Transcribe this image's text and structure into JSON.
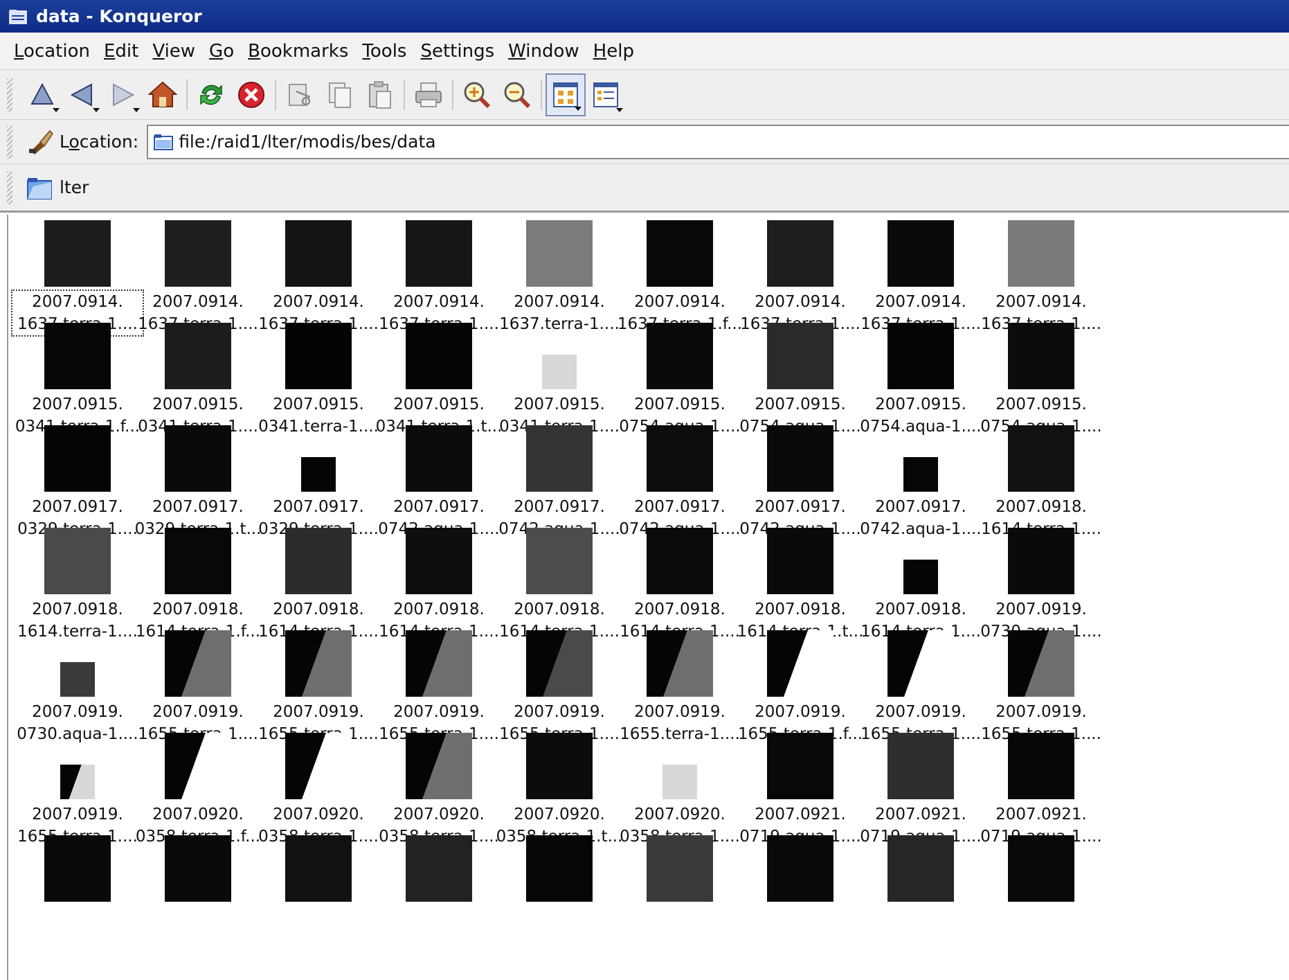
{
  "window": {
    "title": "data - Konqueror"
  },
  "menu": [
    {
      "label": "Location",
      "key": "L",
      "rest": "ocation"
    },
    {
      "label": "Edit",
      "key": "E",
      "rest": "dit"
    },
    {
      "label": "View",
      "key": "V",
      "rest": "iew"
    },
    {
      "label": "Go",
      "key": "G",
      "rest": "o"
    },
    {
      "label": "Bookmarks",
      "key": "B",
      "rest": "ookmarks"
    },
    {
      "label": "Tools",
      "key": "T",
      "rest": "ools"
    },
    {
      "label": "Settings",
      "key": "S",
      "rest": "ettings"
    },
    {
      "label": "Window",
      "key": "W",
      "rest": "indow"
    },
    {
      "label": "Help",
      "key": "H",
      "rest": "elp"
    }
  ],
  "toolbar": {
    "buttons": [
      "up-icon",
      "back-icon",
      "forward-icon",
      "home-icon",
      "reload-icon",
      "stop-icon",
      "cut-icon",
      "copy-icon",
      "paste-icon",
      "print-icon",
      "zoom-in-icon",
      "zoom-out-icon",
      "icon-view-icon",
      "detail-view-icon"
    ]
  },
  "location": {
    "label": "Location:",
    "label_key": "o",
    "value": "file:/raid1/lter/modis/bes/data"
  },
  "bookmarks": [
    {
      "label": "lter"
    }
  ],
  "files": [
    {
      "l1": "2007.0914.",
      "l2": "1637.terra-1....",
      "tone": "#1d1d1d"
    },
    {
      "l1": "2007.0914.",
      "l2": "1637.terra-1....",
      "tone": "#1f1f1f"
    },
    {
      "l1": "2007.0914.",
      "l2": "1637.terra-1....",
      "tone": "#141414"
    },
    {
      "l1": "2007.0914.",
      "l2": "1637.terra-1....",
      "tone": "#161616"
    },
    {
      "l1": "2007.0914.",
      "l2": "1637.terra-1....",
      "tone": "#7b7b7b"
    },
    {
      "l1": "2007.0914.",
      "l2": "1637.terra-1.f...",
      "tone": "#080808"
    },
    {
      "l1": "2007.0914.",
      "l2": "1637.terra-1....",
      "tone": "#1e1e1e"
    },
    {
      "l1": "2007.0914.",
      "l2": "1637.terra-1....",
      "tone": "#0a0a0a"
    },
    {
      "l1": "2007.0914.",
      "l2": "1637.terra-1....",
      "tone": "#7a7a7a"
    },
    {
      "l1": "2007.0915.",
      "l2": "0341.terra-1.f...",
      "tone": "#060606"
    },
    {
      "l1": "2007.0915.",
      "l2": "0341.terra-1....",
      "tone": "#1c1c1c"
    },
    {
      "l1": "2007.0915.",
      "l2": "0341.terra-1....",
      "tone": "#030303"
    },
    {
      "l1": "2007.0915.",
      "l2": "0341.terra-1.t...",
      "tone": "#050505"
    },
    {
      "l1": "2007.0915.",
      "l2": "0341.terra-1....",
      "tone": "#d8d8d8",
      "small": true
    },
    {
      "l1": "2007.0915.",
      "l2": "0754.aqua-1....",
      "tone": "#0a0a0a"
    },
    {
      "l1": "2007.0915.",
      "l2": "0754.aqua-1....",
      "tone": "#2a2a2a"
    },
    {
      "l1": "2007.0915.",
      "l2": "0754.aqua-1....",
      "tone": "#050505"
    },
    {
      "l1": "2007.0915.",
      "l2": "0754.aqua-1....",
      "tone": "#0c0c0c"
    },
    {
      "l1": "2007.0917.",
      "l2": "0329.terra-1....",
      "tone": "#040404"
    },
    {
      "l1": "2007.0917.",
      "l2": "0329.terra-1.t...",
      "tone": "#0a0a0a"
    },
    {
      "l1": "2007.0917.",
      "l2": "0329.terra-1....",
      "tone": "#050505",
      "small": true
    },
    {
      "l1": "2007.0917.",
      "l2": "0742.aqua-1....",
      "tone": "#0c0c0c"
    },
    {
      "l1": "2007.0917.",
      "l2": "0742.aqua-1....",
      "tone": "#343434"
    },
    {
      "l1": "2007.0917.",
      "l2": "0742.aqua-1....",
      "tone": "#0d0d0d"
    },
    {
      "l1": "2007.0917.",
      "l2": "0742.aqua-1....",
      "tone": "#0a0a0a"
    },
    {
      "l1": "2007.0917.",
      "l2": "0742.aqua-1....",
      "tone": "#060606",
      "small": true
    },
    {
      "l1": "2007.0918.",
      "l2": "1614.terra-1....",
      "tone": "#111111"
    },
    {
      "l1": "2007.0918.",
      "l2": "1614.terra-1....",
      "tone": "#4a4a4a"
    },
    {
      "l1": "2007.0918.",
      "l2": "1614.terra-1.f...",
      "tone": "#080808"
    },
    {
      "l1": "2007.0918.",
      "l2": "1614.terra-1....",
      "tone": "#2c2c2c"
    },
    {
      "l1": "2007.0918.",
      "l2": "1614.terra-1....",
      "tone": "#0e0e0e"
    },
    {
      "l1": "2007.0918.",
      "l2": "1614.terra-1....",
      "tone": "#4c4c4c"
    },
    {
      "l1": "2007.0918.",
      "l2": "1614.terra-1....",
      "tone": "#0b0b0b"
    },
    {
      "l1": "2007.0918.",
      "l2": "1614.terra-1.t...",
      "tone": "#090909"
    },
    {
      "l1": "2007.0918.",
      "l2": "1614.terra-1....",
      "tone": "#050505",
      "small": true
    },
    {
      "l1": "2007.0919.",
      "l2": "0730.aqua-1....",
      "tone": "#0a0a0a"
    },
    {
      "l1": "2007.0919.",
      "l2": "0730.aqua-1....",
      "tone": "#3a3a3a",
      "small": true
    },
    {
      "l1": "2007.0919.",
      "l2": "1655.terra-1....",
      "tone": "#6e6e6e",
      "split": true
    },
    {
      "l1": "2007.0919.",
      "l2": "1655.terra-1....",
      "tone": "#6e6e6e",
      "split": true
    },
    {
      "l1": "2007.0919.",
      "l2": "1655.terra-1....",
      "tone": "#6e6e6e",
      "split": true
    },
    {
      "l1": "2007.0919.",
      "l2": "1655.terra-1....",
      "tone": "#4a4a4a",
      "split": true
    },
    {
      "l1": "2007.0919.",
      "l2": "1655.terra-1....",
      "tone": "#6e6e6e",
      "split": true
    },
    {
      "l1": "2007.0919.",
      "l2": "1655.terra-1.f...",
      "tone": "#ffffff",
      "split": true
    },
    {
      "l1": "2007.0919.",
      "l2": "1655.terra-1....",
      "tone": "#ffffff",
      "split": true
    },
    {
      "l1": "2007.0919.",
      "l2": "1655.terra-1....",
      "tone": "#6e6e6e",
      "split": true
    },
    {
      "l1": "2007.0919.",
      "l2": "1655.terra-1....",
      "tone": "#d8d8d8",
      "small": true,
      "split": true
    },
    {
      "l1": "2007.0920.",
      "l2": "0358.terra-1.f...",
      "tone": "#ffffff",
      "split": true
    },
    {
      "l1": "2007.0920.",
      "l2": "0358.terra-1....",
      "tone": "#ffffff",
      "split": true
    },
    {
      "l1": "2007.0920.",
      "l2": "0358.terra-1....",
      "tone": "#6e6e6e",
      "split": true
    },
    {
      "l1": "2007.0920.",
      "l2": "0358.terra-1.t...",
      "tone": "#0c0c0c"
    },
    {
      "l1": "2007.0920.",
      "l2": "0358.terra-1....",
      "tone": "#d8d8d8",
      "small": true
    },
    {
      "l1": "2007.0921.",
      "l2": "0719.aqua-1....",
      "tone": "#080808"
    },
    {
      "l1": "2007.0921.",
      "l2": "0719.aqua-1....",
      "tone": "#2e2e2e"
    },
    {
      "l1": "2007.0921.",
      "l2": "0719.aqua-1....",
      "tone": "#070707"
    },
    {
      "l1": "",
      "l2": "",
      "tone": "#0a0a0a"
    },
    {
      "l1": "",
      "l2": "",
      "tone": "#0a0a0a"
    },
    {
      "l1": "",
      "l2": "",
      "tone": "#111111"
    },
    {
      "l1": "",
      "l2": "",
      "tone": "#222222"
    },
    {
      "l1": "",
      "l2": "",
      "tone": "#060606"
    },
    {
      "l1": "",
      "l2": "",
      "tone": "#3a3a3a"
    },
    {
      "l1": "",
      "l2": "",
      "tone": "#0a0a0a"
    },
    {
      "l1": "",
      "l2": "",
      "tone": "#262626"
    },
    {
      "l1": "",
      "l2": "",
      "tone": "#080808"
    }
  ]
}
